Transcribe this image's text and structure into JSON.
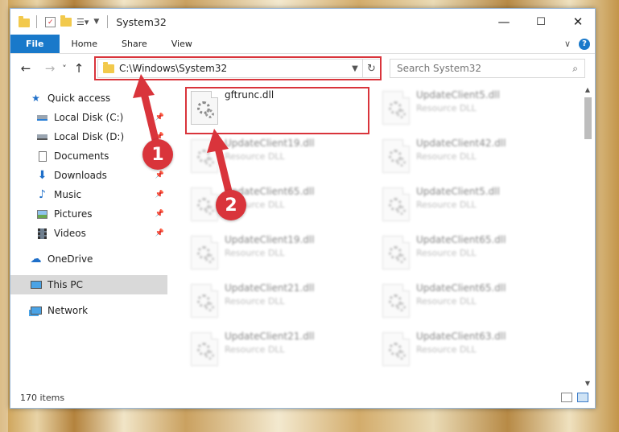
{
  "window": {
    "title": "System32",
    "controls": {
      "minimize": "—",
      "maximize": "☐",
      "close": "✕"
    }
  },
  "ribbon": {
    "tabs": [
      "File",
      "Home",
      "Share",
      "View"
    ],
    "help": "?",
    "expand": "∨"
  },
  "nav": {
    "back": "←",
    "forward": "→",
    "recent": "˅",
    "up": "↑",
    "address": "C:\\Windows\\System32",
    "refresh": "↻",
    "search_placeholder": "Search System32"
  },
  "sidebar": {
    "items": [
      {
        "label": "Quick access",
        "icon": "star-icon",
        "pinned": false,
        "selected": false
      },
      {
        "label": "Local Disk (C:)",
        "icon": "drive-icon",
        "pinned": true,
        "selected": false
      },
      {
        "label": "Local Disk (D:)",
        "icon": "drive-icon",
        "pinned": true,
        "selected": false
      },
      {
        "label": "Documents",
        "icon": "document-icon",
        "pinned": true,
        "selected": false
      },
      {
        "label": "Downloads",
        "icon": "download-icon",
        "pinned": true,
        "selected": false
      },
      {
        "label": "Music",
        "icon": "music-icon",
        "pinned": true,
        "selected": false
      },
      {
        "label": "Pictures",
        "icon": "picture-icon",
        "pinned": true,
        "selected": false
      },
      {
        "label": "Videos",
        "icon": "video-icon",
        "pinned": true,
        "selected": false
      },
      {
        "label": "OneDrive",
        "icon": "cloud-icon",
        "pinned": false,
        "selected": false
      },
      {
        "label": "This PC",
        "icon": "computer-icon",
        "pinned": false,
        "selected": true
      },
      {
        "label": "Network",
        "icon": "network-icon",
        "pinned": false,
        "selected": false
      }
    ]
  },
  "files": [
    {
      "name": "gftrunc.dll",
      "desc": "",
      "highlighted": true
    },
    {
      "name": "UpdateClient5.dll",
      "desc": "Resource DLL",
      "highlighted": false
    },
    {
      "name": "UpdateClient19.dll",
      "desc": "Resource DLL",
      "highlighted": false
    },
    {
      "name": "UpdateClient42.dll",
      "desc": "Resource DLL",
      "highlighted": false
    },
    {
      "name": "UpdateClient65.dll",
      "desc": "Resource DLL",
      "highlighted": false
    },
    {
      "name": "UpdateClient5.dll",
      "desc": "Resource DLL",
      "highlighted": false
    },
    {
      "name": "UpdateClient19.dll",
      "desc": "Resource DLL",
      "highlighted": false
    },
    {
      "name": "UpdateClient65.dll",
      "desc": "Resource DLL",
      "highlighted": false
    },
    {
      "name": "UpdateClient21.dll",
      "desc": "Resource DLL",
      "highlighted": false
    },
    {
      "name": "UpdateClient65.dll",
      "desc": "Resource DLL",
      "highlighted": false
    },
    {
      "name": "UpdateClient21.dll",
      "desc": "Resource DLL",
      "highlighted": false
    },
    {
      "name": "UpdateClient63.dll",
      "desc": "Resource DLL",
      "highlighted": false
    }
  ],
  "status": {
    "item_count": "170 items"
  },
  "annotations": {
    "step1": "1",
    "step2": "2",
    "color": "#d9343b"
  }
}
